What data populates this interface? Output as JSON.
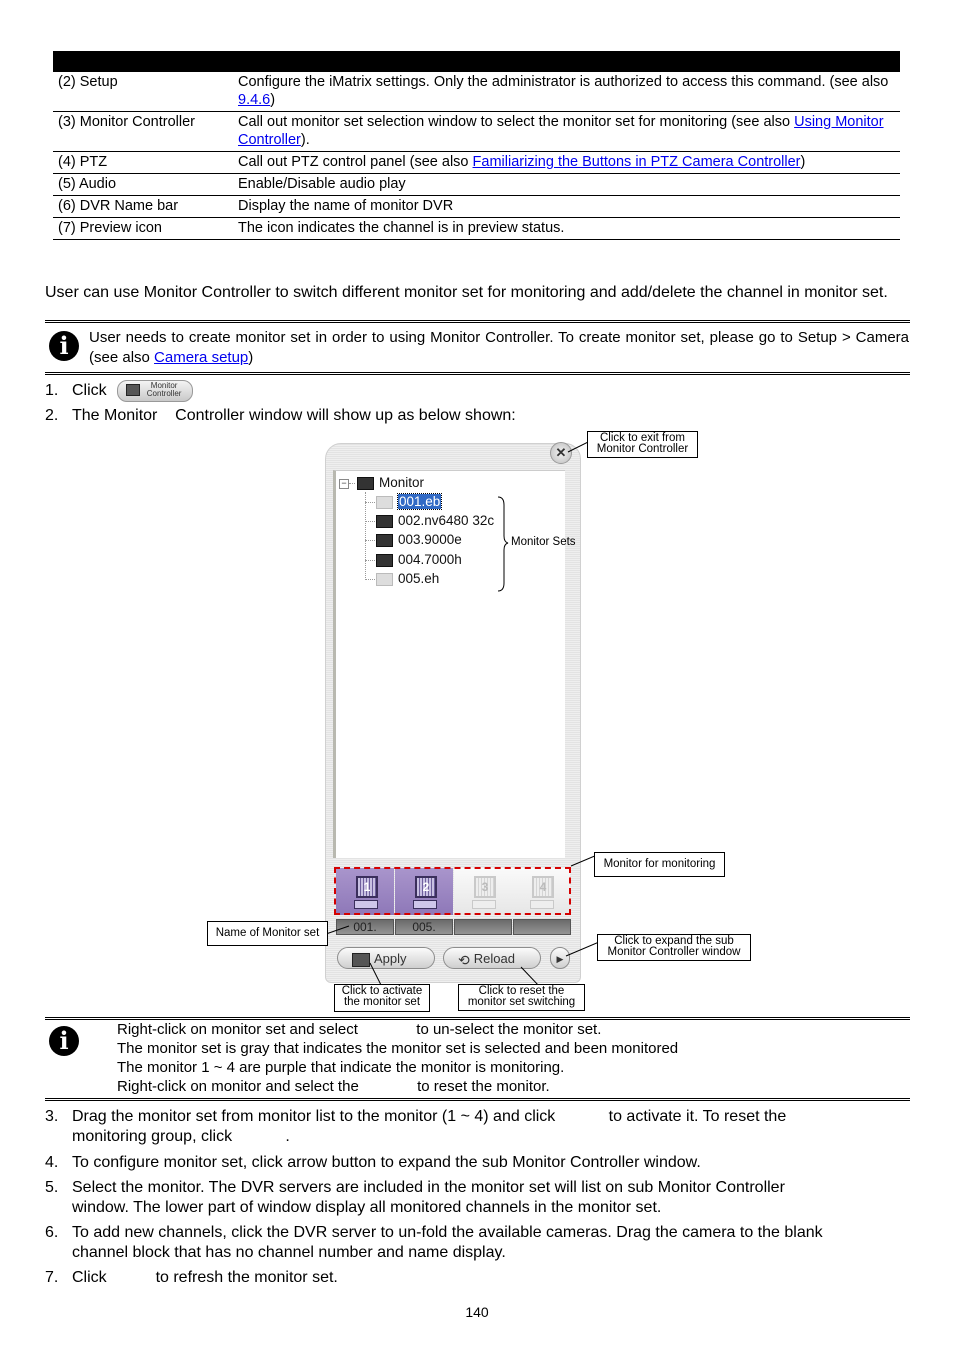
{
  "table": {
    "rows": [
      {
        "item": "(2) Setup",
        "desc_before": "Configure the iMatrix settings. Only the administrator is authorized to access this command. (see also ",
        "link": "9.4.6",
        "desc_after": ")"
      },
      {
        "item": "(3) Monitor Controller",
        "desc_before": "Call out monitor set selection window to select the monitor set for monitoring (see also ",
        "link": "Using Monitor Controller",
        "desc_after": ")."
      },
      {
        "item": "(4) PTZ",
        "desc_before": "Call out PTZ control panel (see also ",
        "link": "Familiarizing the Buttons in PTZ Camera Controller",
        "desc_after": ")"
      },
      {
        "item": "(5) Audio",
        "desc_before": "Enable/Disable audio play",
        "link": "",
        "desc_after": ""
      },
      {
        "item": "(6) DVR Name bar",
        "desc_before": "Display the name of monitor DVR",
        "link": "",
        "desc_after": ""
      },
      {
        "item": "(7) Preview icon",
        "desc_before": "The icon indicates the channel is in preview status.",
        "link": "",
        "desc_after": ""
      }
    ]
  },
  "intro": "User can use Monitor Controller to switch different monitor set for monitoring and add/delete the channel in monitor set.",
  "note1": {
    "icon": "info-icon",
    "text_before": "User needs to create monitor set in order to using Monitor Controller. To create monitor set, please go to Setup > Camera (see also ",
    "link": "Camera setup",
    "text_after": ")"
  },
  "steps_top": [
    {
      "num": "1.",
      "text": "Click",
      "button_label_line1": "Monitor",
      "button_label_line2": "Controller"
    },
    {
      "num": "2.",
      "text": "The Monitor    Controller window will show up as below shown:"
    }
  ],
  "monitor_controller": {
    "close_glyph": "✕",
    "tree_root": "Monitor",
    "expand_glyph": "−",
    "monitor_sets": [
      {
        "name": "001.eb",
        "state": "gray",
        "selected": true
      },
      {
        "name": "002.nv6480 32c",
        "state": "normal",
        "selected": false
      },
      {
        "name": "003.9000e",
        "state": "normal",
        "selected": false
      },
      {
        "name": "004.7000h",
        "state": "normal",
        "selected": false
      },
      {
        "name": "005.eh",
        "state": "gray",
        "selected": false
      }
    ],
    "monitors": [
      {
        "number": "1",
        "active": true,
        "set_name": "001."
      },
      {
        "number": "2",
        "active": true,
        "set_name": "005."
      },
      {
        "number": "3",
        "active": false,
        "set_name": ""
      },
      {
        "number": "4",
        "active": false,
        "set_name": ""
      }
    ],
    "apply_label": "Apply",
    "reload_label": "Reload",
    "expand_arrow_glyph": "▶",
    "active_color": "#9a86c2"
  },
  "callouts": {
    "exit": "Click to exit from Monitor Controller",
    "monitor_sets": "Monitor Sets",
    "monitor_for_monitoring": "Monitor for monitoring",
    "name_of_set": "Name of Monitor set",
    "expand": "Click to expand the sub Monitor Controller window",
    "activate": "Click to activate the monitor set",
    "reset": "Click to reset the monitor set switching"
  },
  "note2": {
    "lines": [
      "Right-click on monitor set and select              to un-select the monitor set.",
      "The monitor set is gray that indicates the monitor set is selected and been monitored",
      "The monitor 1 ~ 4 are purple that indicate the monitor is monitoring.",
      "Right-click on monitor and select the              to reset the monitor."
    ]
  },
  "steps_bottom": [
    {
      "num": "3.",
      "line1": "Drag the monitor set from monitor list to the monitor (1 ~ 4) and click            to activate it. To reset the",
      "line2": "monitoring group, click            ."
    },
    {
      "num": "4.",
      "line1": "To configure monitor set, click arrow button to expand the sub Monitor Controller window.",
      "line2": ""
    },
    {
      "num": "5.",
      "line1": "Select the monitor. The DVR servers are included in the monitor set will list on sub Monitor Controller",
      "line2": "window. The lower part of window display all monitored channels in the monitor set."
    },
    {
      "num": "6.",
      "line1": "To add new channels, click the DVR server to un-fold the available cameras. Drag the camera to the blank",
      "line2": "channel block that has no channel number and name display."
    },
    {
      "num": "7.",
      "line1": "Click           to refresh the monitor set.",
      "line2": ""
    }
  ],
  "page_number": "140"
}
